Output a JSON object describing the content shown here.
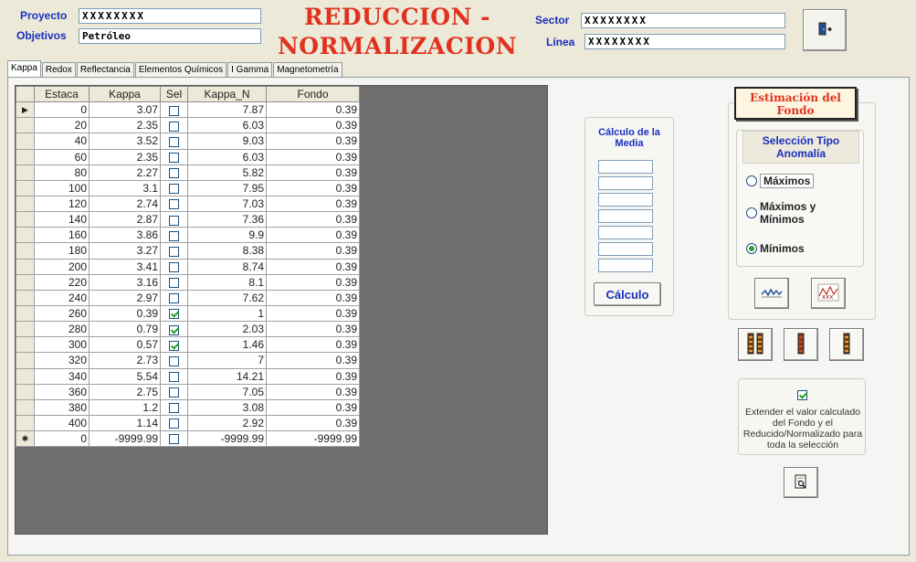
{
  "header": {
    "proyecto_label": "Proyecto",
    "proyecto_value": "XXXXXXXX",
    "objetivos_label": "Objetivos",
    "objetivos_value": "Petróleo",
    "title_line1": "REDUCCION -",
    "title_line2": "NORMALIZACION",
    "sector_label": "Sector",
    "sector_value": "XXXXXXXX",
    "linea_label": "Línea",
    "linea_value": "XXXXXXXX",
    "exit_icon": "exit-door-icon"
  },
  "tabs": [
    {
      "label": "Kappa",
      "active": true
    },
    {
      "label": "Redox",
      "active": false
    },
    {
      "label": "Reflectancia",
      "active": false
    },
    {
      "label": "Elementos Químicos",
      "active": false
    },
    {
      "label": "I Gamma",
      "active": false
    },
    {
      "label": "Magnetometría",
      "active": false
    }
  ],
  "grid": {
    "columns": [
      "Estaca",
      "Kappa",
      "Sel",
      "Kappa_N",
      "Fondo"
    ],
    "rows": [
      {
        "estaca": "0",
        "kappa": "3.07",
        "sel": false,
        "kappa_n": "7.87",
        "fondo": "0.39",
        "marker": "▶"
      },
      {
        "estaca": "20",
        "kappa": "2.35",
        "sel": false,
        "kappa_n": "6.03",
        "fondo": "0.39",
        "marker": ""
      },
      {
        "estaca": "40",
        "kappa": "3.52",
        "sel": false,
        "kappa_n": "9.03",
        "fondo": "0.39",
        "marker": ""
      },
      {
        "estaca": "60",
        "kappa": "2.35",
        "sel": false,
        "kappa_n": "6.03",
        "fondo": "0.39",
        "marker": ""
      },
      {
        "estaca": "80",
        "kappa": "2.27",
        "sel": false,
        "kappa_n": "5.82",
        "fondo": "0.39",
        "marker": ""
      },
      {
        "estaca": "100",
        "kappa": "3.1",
        "sel": false,
        "kappa_n": "7.95",
        "fondo": "0.39",
        "marker": ""
      },
      {
        "estaca": "120",
        "kappa": "2.74",
        "sel": false,
        "kappa_n": "7.03",
        "fondo": "0.39",
        "marker": ""
      },
      {
        "estaca": "140",
        "kappa": "2.87",
        "sel": false,
        "kappa_n": "7.36",
        "fondo": "0.39",
        "marker": ""
      },
      {
        "estaca": "160",
        "kappa": "3.86",
        "sel": false,
        "kappa_n": "9.9",
        "fondo": "0.39",
        "marker": ""
      },
      {
        "estaca": "180",
        "kappa": "3.27",
        "sel": false,
        "kappa_n": "8.38",
        "fondo": "0.39",
        "marker": ""
      },
      {
        "estaca": "200",
        "kappa": "3.41",
        "sel": false,
        "kappa_n": "8.74",
        "fondo": "0.39",
        "marker": ""
      },
      {
        "estaca": "220",
        "kappa": "3.16",
        "sel": false,
        "kappa_n": "8.1",
        "fondo": "0.39",
        "marker": ""
      },
      {
        "estaca": "240",
        "kappa": "2.97",
        "sel": false,
        "kappa_n": "7.62",
        "fondo": "0.39",
        "marker": ""
      },
      {
        "estaca": "260",
        "kappa": "0.39",
        "sel": true,
        "kappa_n": "1",
        "fondo": "0.39",
        "marker": ""
      },
      {
        "estaca": "280",
        "kappa": "0.79",
        "sel": true,
        "kappa_n": "2.03",
        "fondo": "0.39",
        "marker": ""
      },
      {
        "estaca": "300",
        "kappa": "0.57",
        "sel": true,
        "kappa_n": "1.46",
        "fondo": "0.39",
        "marker": ""
      },
      {
        "estaca": "320",
        "kappa": "2.73",
        "sel": false,
        "kappa_n": "7",
        "fondo": "0.39",
        "marker": ""
      },
      {
        "estaca": "340",
        "kappa": "5.54",
        "sel": false,
        "kappa_n": "14.21",
        "fondo": "0.39",
        "marker": ""
      },
      {
        "estaca": "360",
        "kappa": "2.75",
        "sel": false,
        "kappa_n": "7.05",
        "fondo": "0.39",
        "marker": ""
      },
      {
        "estaca": "380",
        "kappa": "1.2",
        "sel": false,
        "kappa_n": "3.08",
        "fondo": "0.39",
        "marker": ""
      },
      {
        "estaca": "400",
        "kappa": "1.14",
        "sel": false,
        "kappa_n": "2.92",
        "fondo": "0.39",
        "marker": ""
      },
      {
        "estaca": "0",
        "kappa": "-9999.99",
        "sel": false,
        "kappa_n": "-9999.99",
        "fondo": "-9999.99",
        "marker": "✱"
      }
    ]
  },
  "media": {
    "title": "Cálculo de la Media",
    "inputs": [
      "",
      "",
      "",
      "",
      "",
      "",
      ""
    ],
    "button": "Cálculo"
  },
  "fondo": {
    "button": "Estimación del Fondo",
    "group_title": "Selección Tipo Anomalía",
    "options": [
      {
        "label": "Máximos",
        "checked": false
      },
      {
        "label": "Máximos y Mínimos",
        "checked": false
      },
      {
        "label": "Mínimos",
        "checked": true
      }
    ],
    "icons": [
      "wave-chart-icon",
      "xxx-chart-icon"
    ]
  },
  "column_icons": [
    "multi-column-icon",
    "single-column-icon",
    "right-column-icon"
  ],
  "extend": {
    "checked": true,
    "text": "Extender el valor calculado del Fondo y el Reducido/Normalizado para toda la selección",
    "icon": "print-preview-icon"
  },
  "colors": {
    "title": "#e0321e",
    "label_blue": "#1a2fbf",
    "grid_bg": "#6e6e6e"
  }
}
